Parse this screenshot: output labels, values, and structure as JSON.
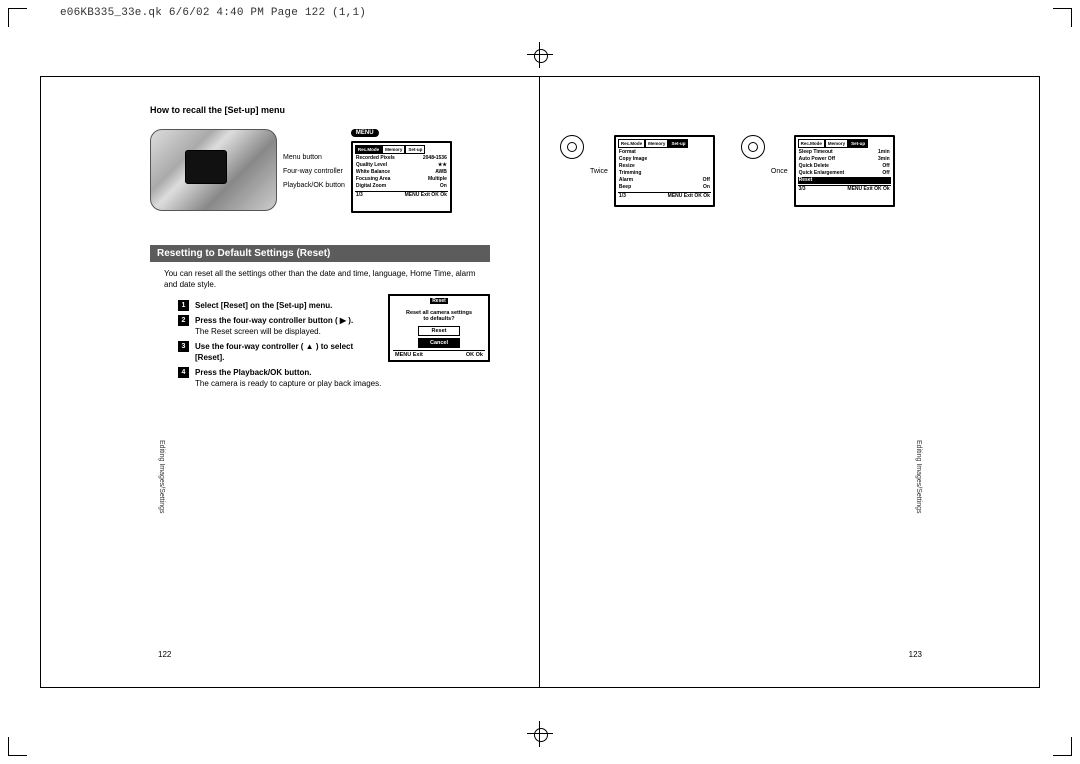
{
  "slug": "e06KB335_33e.qk  6/6/02 4:40 PM  Page 122 (1,1)",
  "heading": "How to recall the [Set-up] menu",
  "camera_labels": {
    "menu": "Menu button",
    "fourway": "Four-way controller",
    "playback": "Playback/OK button"
  },
  "menu_badge": "MENU",
  "lcd1": {
    "tabs": [
      "Rec.Mode",
      "Memory",
      "Set-up"
    ],
    "active_tab": 0,
    "rows": [
      [
        "Recorded Pixels",
        "2048•1536"
      ],
      [
        "Quality Level",
        "★★"
      ],
      [
        "White Balance",
        "AWB"
      ],
      [
        "Focusing Area",
        "Multiple"
      ],
      [
        "Digital Zoom",
        "On"
      ]
    ],
    "page": "1/3",
    "foot": [
      "MENU Exit",
      "OK Ok"
    ]
  },
  "nav_twice": "Twice",
  "nav_once": "Once",
  "lcd2": {
    "tabs": [
      "Rec.Mode",
      "Memory",
      "Set-up"
    ],
    "active_tab": 2,
    "rows": [
      [
        "Format",
        ""
      ],
      [
        "Copy Image",
        ""
      ],
      [
        "Resize",
        ""
      ],
      [
        "Trimming",
        ""
      ],
      [
        "Alarm",
        "Off"
      ],
      [
        "Beep",
        "On"
      ]
    ],
    "page": "1/3",
    "foot": [
      "MENU Exit",
      "OK Ok"
    ]
  },
  "lcd3": {
    "tabs": [
      "Rec.Mode",
      "Memory",
      "Set-up"
    ],
    "active_tab": 2,
    "rows": [
      [
        "Sleep Timeout",
        "1min"
      ],
      [
        "Auto Power Off",
        "3min"
      ],
      [
        "Quick Delete",
        "Off"
      ],
      [
        "Quick Enlargement",
        "Off"
      ],
      [
        "Reset",
        ""
      ]
    ],
    "highlight": 4,
    "page": "3/3",
    "foot": [
      "MENU Exit",
      "OK Ok"
    ]
  },
  "section_title": "Resetting to Default Settings (Reset)",
  "intro": "You can reset all the settings other than the date and time, language, Home Time, alarm and date style.",
  "steps": [
    {
      "n": "1",
      "bold": "Select [Reset] on the [Set-up] menu.",
      "plain": ""
    },
    {
      "n": "2",
      "bold": "Press the four-way controller button ( ▶ ).",
      "plain": "The Reset screen will be displayed."
    },
    {
      "n": "3",
      "bold": "Use the four-way controller ( ▲ ) to select [Reset].",
      "plain": ""
    },
    {
      "n": "4",
      "bold": "Press the Playback/OK button.",
      "plain": "The camera is ready to capture or play back images."
    }
  ],
  "reset_lcd": {
    "header": "Reset",
    "msg1": "Reset all camera settings",
    "msg2": "to defaults?",
    "btn1": "Reset",
    "btn2": "Cancel",
    "foot": [
      "MENU Exit",
      "OK Ok"
    ]
  },
  "side": "Editing Images/Settings",
  "page_left": "122",
  "page_right": "123"
}
